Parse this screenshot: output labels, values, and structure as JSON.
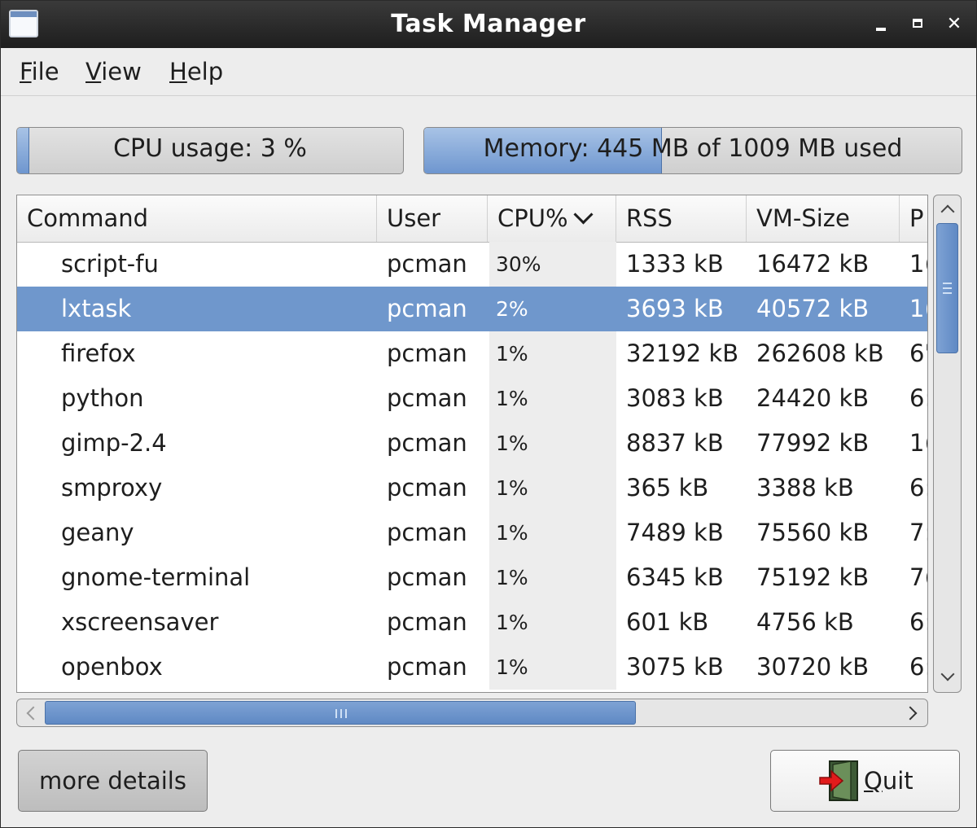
{
  "window": {
    "title": "Task Manager"
  },
  "menu": {
    "file": {
      "mnemonic": "F",
      "rest": "ile"
    },
    "view": {
      "mnemonic": "V",
      "rest": "iew"
    },
    "help": {
      "mnemonic": "H",
      "rest": "elp"
    }
  },
  "cpu_meter": {
    "label": "CPU usage: 3 %",
    "fraction": 0.03
  },
  "memory_meter": {
    "label": "Memory: 445 MB of 1009 MB used",
    "used_mb": 445,
    "total_mb": 1009
  },
  "table": {
    "columns": [
      "Command",
      "User",
      "CPU%",
      "RSS",
      "VM-Size",
      "P"
    ],
    "rows": [
      {
        "command": "script-fu",
        "user": "pcman",
        "cpu": "30%",
        "rss": "1333 kB",
        "vm": "16472 kB",
        "pid": "1("
      },
      {
        "command": "lxtask",
        "user": "pcman",
        "cpu": "2%",
        "rss": "3693 kB",
        "vm": "40572 kB",
        "pid": "1("
      },
      {
        "command": "firefox",
        "user": "pcman",
        "cpu": "1%",
        "rss": "32192 kB",
        "vm": "262608 kB",
        "pid": "6'"
      },
      {
        "command": "python",
        "user": "pcman",
        "cpu": "1%",
        "rss": "3083 kB",
        "vm": "24420 kB",
        "pid": "6:"
      },
      {
        "command": "gimp-2.4",
        "user": "pcman",
        "cpu": "1%",
        "rss": "8837 kB",
        "vm": "77992 kB",
        "pid": "1("
      },
      {
        "command": "smproxy",
        "user": "pcman",
        "cpu": "1%",
        "rss": "365 kB",
        "vm": "3388 kB",
        "pid": "6:"
      },
      {
        "command": "geany",
        "user": "pcman",
        "cpu": "1%",
        "rss": "7489 kB",
        "vm": "75560 kB",
        "pid": "7:"
      },
      {
        "command": "gnome-terminal",
        "user": "pcman",
        "cpu": "1%",
        "rss": "6345 kB",
        "vm": "75192 kB",
        "pid": "7("
      },
      {
        "command": "xscreensaver",
        "user": "pcman",
        "cpu": "1%",
        "rss": "601 kB",
        "vm": "4756 kB",
        "pid": "6:"
      },
      {
        "command": "openbox",
        "user": "pcman",
        "cpu": "1%",
        "rss": "3075 kB",
        "vm": "30720 kB",
        "pid": "6:"
      }
    ],
    "selected_index": 1,
    "sort_column": "CPU%",
    "sort_direction": "descending"
  },
  "buttons": {
    "more_details": "more details",
    "quit": {
      "mnemonic": "Q",
      "rest": "uit"
    }
  },
  "colors": {
    "selection": "#6f97cc",
    "meter_fill": "#6e96cf",
    "titlebar": "#1e1e1e"
  },
  "icons": [
    "app-window-icon",
    "minimize-icon",
    "maximize-icon",
    "close-icon",
    "sort-descending-icon",
    "scroll-up-icon",
    "scroll-down-icon",
    "scroll-left-icon",
    "scroll-right-icon",
    "quit-door-icon"
  ]
}
